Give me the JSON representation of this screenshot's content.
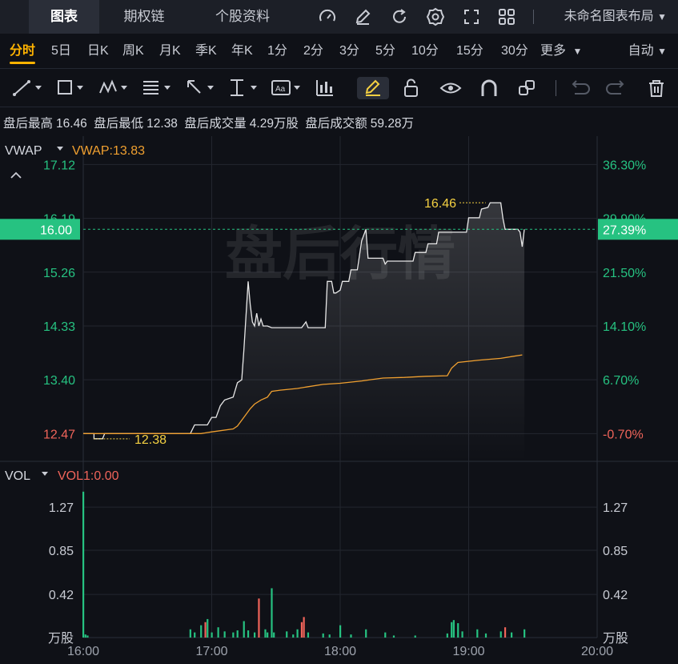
{
  "top_tabs": [
    "图表",
    "期权链",
    "个股资料"
  ],
  "top_tools": [
    "gauge-icon",
    "edit-icon",
    "refresh-icon",
    "gear-icon",
    "fullscreen-icon",
    "grid-icon"
  ],
  "layout_name": "未命名图表布局",
  "periods": [
    "分时",
    "5日",
    "日K",
    "周K",
    "月K",
    "季K",
    "年K",
    "1分",
    "2分",
    "3分",
    "5分",
    "10分",
    "15分",
    "30分",
    "更多"
  ],
  "active_period": "分时",
  "auto_label": "自动",
  "draw_tools": [
    "line-tool-icon",
    "rect-tool-icon",
    "wave-tool-icon",
    "fib-tool-icon",
    "arrow-tool-icon",
    "measure-tool-icon",
    "text-tool-icon",
    "pattern-tool-icon",
    "pencil-icon",
    "unlock-icon",
    "eye-icon",
    "magnet-icon",
    "shapes-icon",
    "undo-icon",
    "redo-icon",
    "trash-icon"
  ],
  "stats": {
    "high_label": "盘后最高",
    "high_value": "16.46",
    "low_label": "盘后最低",
    "low_value": "12.38",
    "vol_label": "盘后成交量",
    "vol_value": "4.29万股",
    "amt_label": "盘后成交额",
    "amt_value": "59.28万"
  },
  "indicator": {
    "name": "VWAP",
    "value_label": "VWAP:13.83"
  },
  "watermark": "盘后行情",
  "current_price": "16.00",
  "current_pct": "27.39%",
  "colors": {
    "up": "#26c281",
    "down": "#f0645a",
    "vwap": "#f0a030",
    "price": "#ffffff",
    "accent": "#ffb300",
    "marker": "#f5d142"
  },
  "chart_data": {
    "type": "line",
    "x_labels": [
      "16:00",
      "17:00",
      "18:00",
      "19:00",
      "20:00"
    ],
    "x_range": [
      0,
      240
    ],
    "y_range": [
      11.99,
      17.61
    ],
    "y_ticks": [
      "17.12",
      "16.19",
      "15.26",
      "14.33",
      "13.40",
      "12.47"
    ],
    "pct_ticks": [
      "36.30%",
      "29.90%",
      "21.50%",
      "14.10%",
      "6.70%",
      "-0.70%"
    ],
    "high_marker": {
      "x": 188,
      "y": 16.46,
      "label": "16.46"
    },
    "low_marker": {
      "x": 5,
      "y": 12.38,
      "label": "12.38"
    },
    "series": [
      {
        "points": [
          [
            0,
            12.47
          ],
          [
            5,
            12.47
          ],
          [
            5,
            12.38
          ],
          [
            9,
            12.38
          ],
          [
            10,
            12.47
          ],
          [
            50,
            12.47
          ],
          [
            52,
            12.62
          ],
          [
            58,
            12.62
          ],
          [
            60,
            12.75
          ],
          [
            62,
            12.75
          ],
          [
            64,
            12.95
          ],
          [
            66,
            13.05
          ],
          [
            70,
            13.1
          ],
          [
            72,
            13.35
          ],
          [
            74,
            13.4
          ],
          [
            75,
            13.9
          ],
          [
            76,
            14.5
          ],
          [
            77,
            15.1
          ],
          [
            78,
            14.7
          ],
          [
            79,
            14.4
          ],
          [
            80,
            14.33
          ],
          [
            81,
            14.55
          ],
          [
            82,
            14.33
          ],
          [
            83,
            14.45
          ],
          [
            84,
            14.33
          ],
          [
            86,
            14.33
          ],
          [
            88,
            14.3
          ],
          [
            100,
            14.3
          ],
          [
            102,
            14.3
          ],
          [
            104,
            14.4
          ],
          [
            105,
            14.3
          ],
          [
            112,
            14.3
          ],
          [
            113,
            14.3
          ],
          [
            114,
            15.1
          ],
          [
            116,
            15.1
          ],
          [
            117,
            14.9
          ],
          [
            118,
            14.9
          ],
          [
            120,
            14.95
          ],
          [
            121,
            15.1
          ],
          [
            124,
            15.1
          ],
          [
            125,
            15.3
          ],
          [
            128,
            15.3
          ],
          [
            130,
            15.8
          ],
          [
            132,
            16.0
          ],
          [
            133,
            15.5
          ],
          [
            140,
            15.5
          ],
          [
            141,
            15.4
          ],
          [
            142,
            15.45
          ],
          [
            154,
            15.45
          ],
          [
            155,
            15.6
          ],
          [
            160,
            15.6
          ],
          [
            161,
            15.75
          ],
          [
            165,
            15.75
          ],
          [
            166,
            15.95
          ],
          [
            179,
            15.95
          ],
          [
            180,
            16.2
          ],
          [
            185,
            16.2
          ],
          [
            186,
            16.35
          ],
          [
            189,
            16.38
          ],
          [
            190,
            16.46
          ],
          [
            195,
            16.46
          ],
          [
            196,
            16.19
          ],
          [
            197,
            16.0
          ],
          [
            200,
            16.0
          ],
          [
            203,
            16.0
          ],
          [
            204,
            15.95
          ],
          [
            205,
            15.7
          ],
          [
            206,
            16.0
          ]
        ],
        "color": "#e8e8e8"
      },
      {
        "points": [
          [
            0,
            12.47
          ],
          [
            55,
            12.47
          ],
          [
            60,
            12.5
          ],
          [
            70,
            12.55
          ],
          [
            72,
            12.6
          ],
          [
            75,
            12.75
          ],
          [
            78,
            12.9
          ],
          [
            80,
            12.98
          ],
          [
            83,
            13.05
          ],
          [
            86,
            13.1
          ],
          [
            88,
            13.2
          ],
          [
            92,
            13.22
          ],
          [
            100,
            13.25
          ],
          [
            105,
            13.28
          ],
          [
            112,
            13.32
          ],
          [
            120,
            13.34
          ],
          [
            130,
            13.38
          ],
          [
            134,
            13.4
          ],
          [
            140,
            13.43
          ],
          [
            150,
            13.44
          ],
          [
            160,
            13.46
          ],
          [
            170,
            13.47
          ],
          [
            172,
            13.6
          ],
          [
            175,
            13.7
          ],
          [
            185,
            13.74
          ],
          [
            195,
            13.77
          ],
          [
            200,
            13.8
          ],
          [
            205,
            13.83
          ]
        ],
        "color": "#f0a030"
      }
    ],
    "vol_ticks": [
      "1.27",
      "0.85",
      "0.42"
    ],
    "vol_unit": "万股",
    "vol_range": [
      0,
      1.45
    ],
    "volume": [
      [
        0,
        1.42,
        "up"
      ],
      [
        1,
        0.03,
        "up"
      ],
      [
        2,
        0.02,
        "up"
      ],
      [
        50,
        0.08,
        "up"
      ],
      [
        52,
        0.05,
        "up"
      ],
      [
        55,
        0.12,
        "up"
      ],
      [
        57,
        0.15,
        "down"
      ],
      [
        58,
        0.18,
        "up"
      ],
      [
        60,
        0.05,
        "up"
      ],
      [
        63,
        0.1,
        "up"
      ],
      [
        66,
        0.06,
        "up"
      ],
      [
        70,
        0.05,
        "up"
      ],
      [
        72,
        0.07,
        "up"
      ],
      [
        75,
        0.16,
        "up"
      ],
      [
        77,
        0.07,
        "up"
      ],
      [
        80,
        0.05,
        "up"
      ],
      [
        82,
        0.38,
        "down"
      ],
      [
        85,
        0.08,
        "up"
      ],
      [
        86,
        0.05,
        "up"
      ],
      [
        88,
        0.48,
        "up"
      ],
      [
        89,
        0.05,
        "up"
      ],
      [
        95,
        0.06,
        "up"
      ],
      [
        98,
        0.03,
        "up"
      ],
      [
        100,
        0.08,
        "up"
      ],
      [
        102,
        0.15,
        "down"
      ],
      [
        103,
        0.2,
        "down"
      ],
      [
        105,
        0.05,
        "up"
      ],
      [
        112,
        0.04,
        "up"
      ],
      [
        115,
        0.03,
        "up"
      ],
      [
        120,
        0.12,
        "up"
      ],
      [
        125,
        0.03,
        "up"
      ],
      [
        132,
        0.08,
        "up"
      ],
      [
        141,
        0.05,
        "up"
      ],
      [
        145,
        0.02,
        "up"
      ],
      [
        155,
        0.02,
        "up"
      ],
      [
        170,
        0.04,
        "up"
      ],
      [
        172,
        0.15,
        "up"
      ],
      [
        173,
        0.17,
        "up"
      ],
      [
        175,
        0.14,
        "up"
      ],
      [
        177,
        0.06,
        "up"
      ],
      [
        184,
        0.08,
        "up"
      ],
      [
        188,
        0.04,
        "up"
      ],
      [
        195,
        0.06,
        "up"
      ],
      [
        197,
        0.1,
        "down"
      ],
      [
        200,
        0.05,
        "up"
      ],
      [
        206,
        0.08,
        "up"
      ]
    ]
  }
}
